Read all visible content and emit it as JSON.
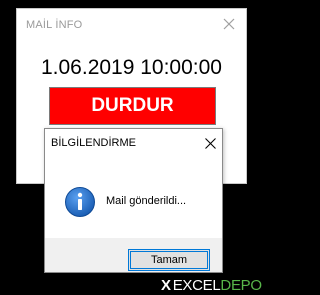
{
  "main_window": {
    "title": "MAİL İNFO",
    "datetime": "1.06.2019 10:00:00",
    "stop_button_label": "DURDUR",
    "close_icon": "close-icon"
  },
  "dialog": {
    "title": "BİLGİLENDİRME",
    "message": "Mail gönderildi...",
    "ok_label": "Tamam",
    "icon": "info-icon",
    "close_icon": "close-icon"
  },
  "watermark": {
    "mark": "X",
    "excel": "EXCEL",
    "depo": "DEPO"
  },
  "colors": {
    "stop_button": "#ff0000",
    "focus_border": "#0078d7",
    "info_icon": "#1b5fb5",
    "watermark_green": "#58b64a"
  }
}
